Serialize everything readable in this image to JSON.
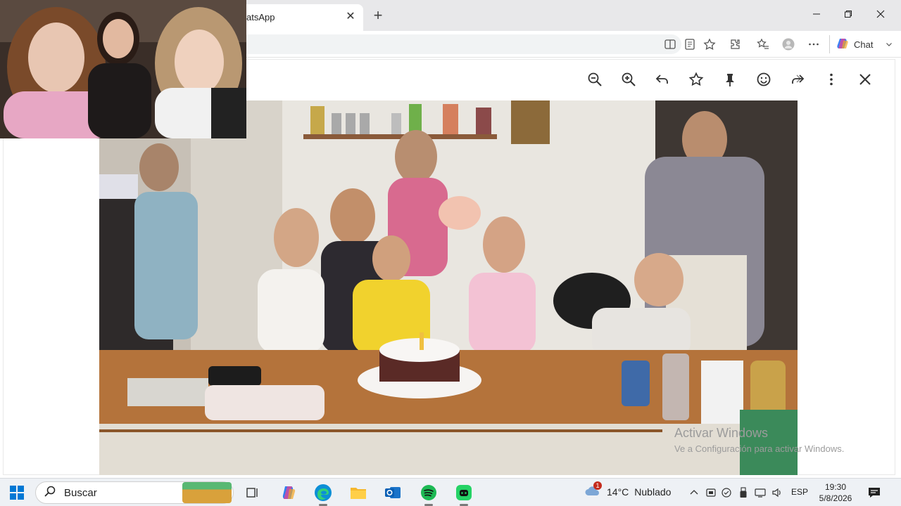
{
  "browser": {
    "tab_title": "atsApp",
    "tab_close_glyph": "✕",
    "new_tab_glyph": "+",
    "window_controls": [
      "minimize-icon",
      "restore-icon",
      "close-icon"
    ],
    "toolbar_icons": [
      "split-screen-icon",
      "reading-view-icon",
      "favorite-star-icon",
      "extensions-icon",
      "favorites-icon",
      "profile-icon",
      "more-icon"
    ],
    "chat_label": "Chat"
  },
  "viewer": {
    "toolbar": [
      "zoom-out-icon",
      "zoom-in-icon",
      "reply-icon",
      "star-icon",
      "pin-icon",
      "emoji-icon",
      "forward-icon",
      "more-vertical-icon",
      "close-icon"
    ]
  },
  "watermark": {
    "title": "Activar Windows",
    "subtitle": "Ve a Configuración para activar Windows."
  },
  "taskbar": {
    "search_placeholder": "Buscar",
    "apps": [
      "task-view-icon",
      "copilot-icon",
      "edge-icon",
      "file-explorer-icon",
      "outlook-icon",
      "spotify-icon",
      "whatsapp-icon"
    ],
    "weather_temp": "14°C",
    "weather_desc": "Nublado",
    "weather_badge": "1",
    "language": "ESP",
    "time": "19:30",
    "date": "5/8/2026"
  },
  "colors": {
    "accent": "#0078d4",
    "spotify": "#1db954",
    "whatsapp": "#25d366",
    "edge": "#0c8fd6"
  }
}
